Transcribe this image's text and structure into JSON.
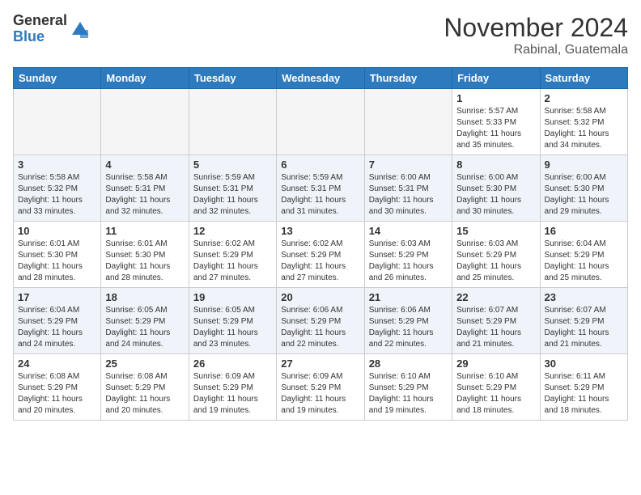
{
  "logo": {
    "general": "General",
    "blue": "Blue"
  },
  "header": {
    "month": "November 2024",
    "location": "Rabinal, Guatemala"
  },
  "weekdays": [
    "Sunday",
    "Monday",
    "Tuesday",
    "Wednesday",
    "Thursday",
    "Friday",
    "Saturday"
  ],
  "weeks": [
    [
      {
        "day": "",
        "info": ""
      },
      {
        "day": "",
        "info": ""
      },
      {
        "day": "",
        "info": ""
      },
      {
        "day": "",
        "info": ""
      },
      {
        "day": "",
        "info": ""
      },
      {
        "day": "1",
        "info": "Sunrise: 5:57 AM\nSunset: 5:33 PM\nDaylight: 11 hours\nand 35 minutes."
      },
      {
        "day": "2",
        "info": "Sunrise: 5:58 AM\nSunset: 5:32 PM\nDaylight: 11 hours\nand 34 minutes."
      }
    ],
    [
      {
        "day": "3",
        "info": "Sunrise: 5:58 AM\nSunset: 5:32 PM\nDaylight: 11 hours\nand 33 minutes."
      },
      {
        "day": "4",
        "info": "Sunrise: 5:58 AM\nSunset: 5:31 PM\nDaylight: 11 hours\nand 32 minutes."
      },
      {
        "day": "5",
        "info": "Sunrise: 5:59 AM\nSunset: 5:31 PM\nDaylight: 11 hours\nand 32 minutes."
      },
      {
        "day": "6",
        "info": "Sunrise: 5:59 AM\nSunset: 5:31 PM\nDaylight: 11 hours\nand 31 minutes."
      },
      {
        "day": "7",
        "info": "Sunrise: 6:00 AM\nSunset: 5:31 PM\nDaylight: 11 hours\nand 30 minutes."
      },
      {
        "day": "8",
        "info": "Sunrise: 6:00 AM\nSunset: 5:30 PM\nDaylight: 11 hours\nand 30 minutes."
      },
      {
        "day": "9",
        "info": "Sunrise: 6:00 AM\nSunset: 5:30 PM\nDaylight: 11 hours\nand 29 minutes."
      }
    ],
    [
      {
        "day": "10",
        "info": "Sunrise: 6:01 AM\nSunset: 5:30 PM\nDaylight: 11 hours\nand 28 minutes."
      },
      {
        "day": "11",
        "info": "Sunrise: 6:01 AM\nSunset: 5:30 PM\nDaylight: 11 hours\nand 28 minutes."
      },
      {
        "day": "12",
        "info": "Sunrise: 6:02 AM\nSunset: 5:29 PM\nDaylight: 11 hours\nand 27 minutes."
      },
      {
        "day": "13",
        "info": "Sunrise: 6:02 AM\nSunset: 5:29 PM\nDaylight: 11 hours\nand 27 minutes."
      },
      {
        "day": "14",
        "info": "Sunrise: 6:03 AM\nSunset: 5:29 PM\nDaylight: 11 hours\nand 26 minutes."
      },
      {
        "day": "15",
        "info": "Sunrise: 6:03 AM\nSunset: 5:29 PM\nDaylight: 11 hours\nand 25 minutes."
      },
      {
        "day": "16",
        "info": "Sunrise: 6:04 AM\nSunset: 5:29 PM\nDaylight: 11 hours\nand 25 minutes."
      }
    ],
    [
      {
        "day": "17",
        "info": "Sunrise: 6:04 AM\nSunset: 5:29 PM\nDaylight: 11 hours\nand 24 minutes."
      },
      {
        "day": "18",
        "info": "Sunrise: 6:05 AM\nSunset: 5:29 PM\nDaylight: 11 hours\nand 24 minutes."
      },
      {
        "day": "19",
        "info": "Sunrise: 6:05 AM\nSunset: 5:29 PM\nDaylight: 11 hours\nand 23 minutes."
      },
      {
        "day": "20",
        "info": "Sunrise: 6:06 AM\nSunset: 5:29 PM\nDaylight: 11 hours\nand 22 minutes."
      },
      {
        "day": "21",
        "info": "Sunrise: 6:06 AM\nSunset: 5:29 PM\nDaylight: 11 hours\nand 22 minutes."
      },
      {
        "day": "22",
        "info": "Sunrise: 6:07 AM\nSunset: 5:29 PM\nDaylight: 11 hours\nand 21 minutes."
      },
      {
        "day": "23",
        "info": "Sunrise: 6:07 AM\nSunset: 5:29 PM\nDaylight: 11 hours\nand 21 minutes."
      }
    ],
    [
      {
        "day": "24",
        "info": "Sunrise: 6:08 AM\nSunset: 5:29 PM\nDaylight: 11 hours\nand 20 minutes."
      },
      {
        "day": "25",
        "info": "Sunrise: 6:08 AM\nSunset: 5:29 PM\nDaylight: 11 hours\nand 20 minutes."
      },
      {
        "day": "26",
        "info": "Sunrise: 6:09 AM\nSunset: 5:29 PM\nDaylight: 11 hours\nand 19 minutes."
      },
      {
        "day": "27",
        "info": "Sunrise: 6:09 AM\nSunset: 5:29 PM\nDaylight: 11 hours\nand 19 minutes."
      },
      {
        "day": "28",
        "info": "Sunrise: 6:10 AM\nSunset: 5:29 PM\nDaylight: 11 hours\nand 19 minutes."
      },
      {
        "day": "29",
        "info": "Sunrise: 6:10 AM\nSunset: 5:29 PM\nDaylight: 11 hours\nand 18 minutes."
      },
      {
        "day": "30",
        "info": "Sunrise: 6:11 AM\nSunset: 5:29 PM\nDaylight: 11 hours\nand 18 minutes."
      }
    ]
  ]
}
